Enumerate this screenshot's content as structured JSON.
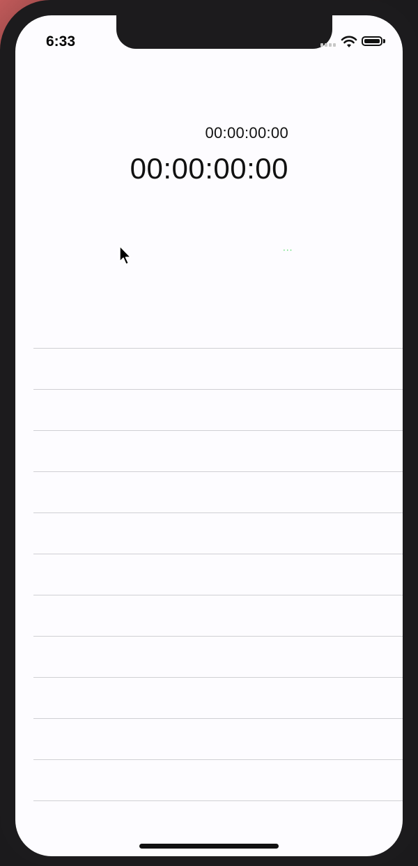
{
  "status_bar": {
    "time": "6:33",
    "signal_icon": "cellular-signal-icon",
    "wifi_icon": "wifi-icon",
    "battery_icon": "battery-icon",
    "battery_level": 1.0
  },
  "stopwatch": {
    "lap_time": "00:00:00:00",
    "main_time": "00:00:00:00",
    "indicator": "···"
  },
  "laps": {
    "rows": [
      "",
      "",
      "",
      "",
      "",
      "",
      "",
      "",
      "",
      "",
      "",
      ""
    ]
  },
  "colors": {
    "background": "#fdfcff",
    "separator": "#cfcfd3",
    "text": "#111111",
    "indicator_green": "#4cd964"
  }
}
